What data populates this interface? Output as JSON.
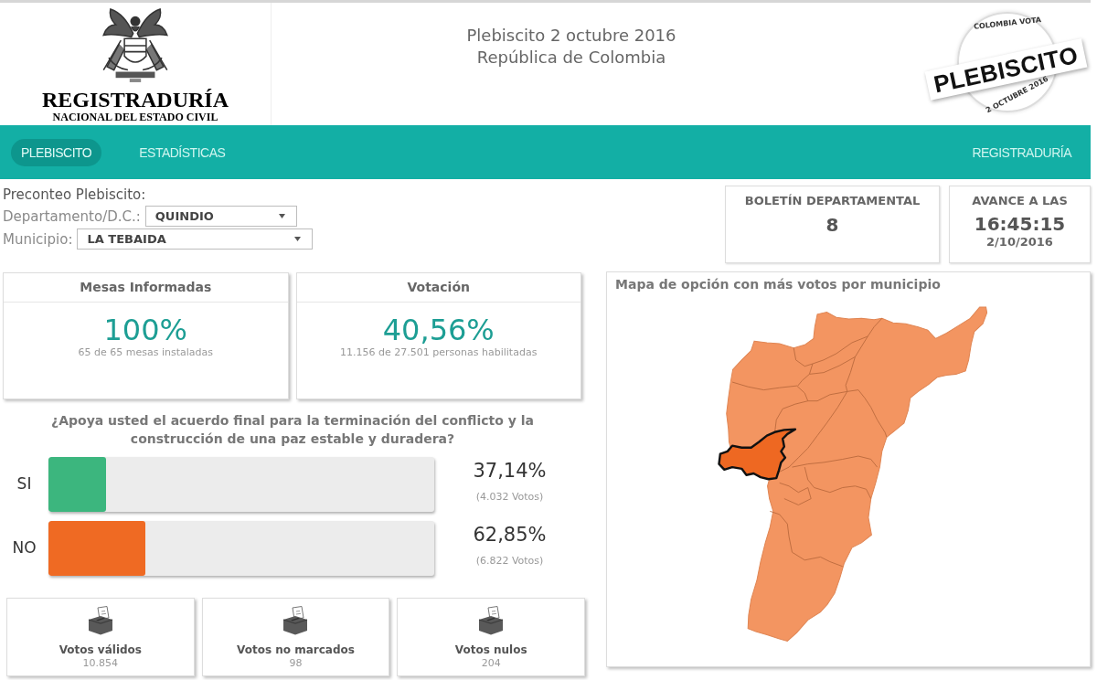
{
  "header": {
    "logo": {
      "title": "REGISTRADURÍA",
      "subtitle": "NACIONAL DEL ESTADO CIVIL"
    },
    "title_lines": [
      "Plebiscito 2 octubre 2016",
      "República de Colombia"
    ],
    "stamp": {
      "top_text": "COLOMBIA VOTA",
      "label": "PLEBISCITO",
      "bottom_text": "2 OCTUBRE 2016"
    }
  },
  "nav": {
    "left_items": [
      {
        "label": "PLEBISCITO",
        "selected": true
      },
      {
        "label": "ESTADÍSTICAS",
        "selected": false
      }
    ],
    "right_items": [
      {
        "label": "REGISTRADURÍA",
        "selected": false
      }
    ]
  },
  "filters": {
    "heading": "Preconteo Plebiscito:",
    "fields": [
      {
        "label": "Departamento/D.C.:",
        "value": "QUINDIO"
      },
      {
        "label": "Municipio:",
        "value": "LA TEBAIDA"
      }
    ]
  },
  "bulletin": {
    "label": "BOLETÍN DEPARTAMENTAL",
    "value": "8"
  },
  "progress_time": {
    "label": "AVANCE A LAS",
    "time": "16:45:15",
    "date": "2/10/2016"
  },
  "stats": [
    {
      "title": "Mesas Informadas",
      "value": "100%",
      "detail": "65 de 65 mesas instaladas"
    },
    {
      "title": "Votación",
      "value": "40,56%",
      "detail": "11.156 de 27.501 personas habilitadas"
    }
  ],
  "question": "¿Apoya usted el acuerdo final para la terminación del conflicto y la construcción de una paz estable y duradera?",
  "options": [
    {
      "label": "SI",
      "color": "#3cb67e",
      "level": 0.15,
      "percent": "37,14%",
      "votes": "(4.032 Votos)"
    },
    {
      "label": "NO",
      "color": "#ef6a23",
      "level": 0.25,
      "percent": "62,85%",
      "votes": "(6.822 Votos)"
    }
  ],
  "totals": [
    {
      "label": "Votos válidos",
      "value": "10.854"
    },
    {
      "label": "Votos no marcados",
      "value": "98"
    },
    {
      "label": "Votos nulos",
      "value": "204"
    }
  ],
  "map": {
    "title": "Mapa de opción con más votos por municipio"
  }
}
